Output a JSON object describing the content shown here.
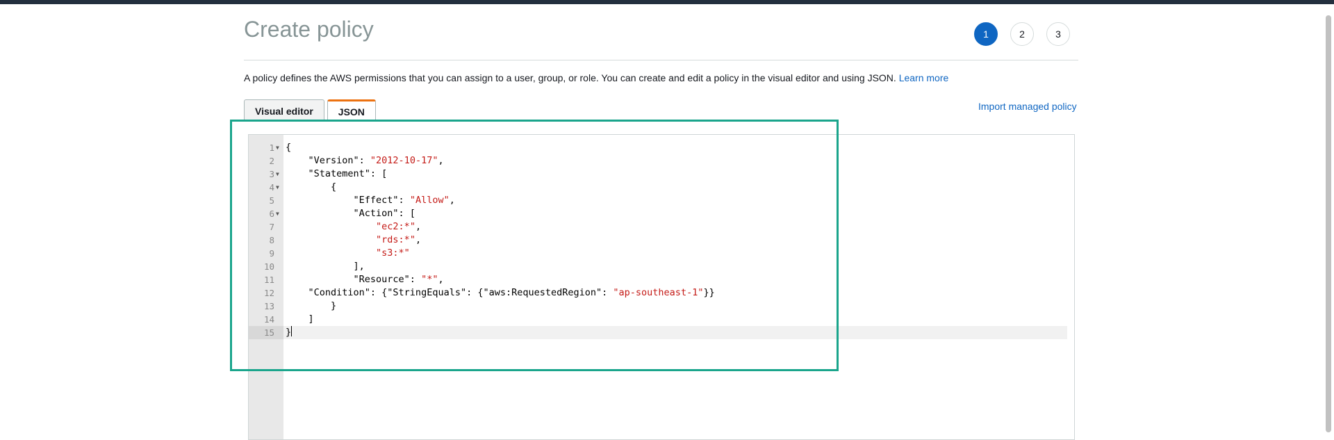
{
  "page": {
    "title": "Create policy",
    "description": "A policy defines the AWS permissions that you can assign to a user, group, or role. You can create and edit a policy in the visual editor and using JSON.",
    "learn_more": "Learn more"
  },
  "steps": [
    "1",
    "2",
    "3"
  ],
  "active_step": "1",
  "tabs": [
    {
      "label": "Visual editor",
      "active": false
    },
    {
      "label": "JSON",
      "active": true
    }
  ],
  "import_managed_policy": "Import managed policy",
  "editor": {
    "line_numbers": [
      "1",
      "2",
      "3",
      "4",
      "5",
      "6",
      "7",
      "8",
      "9",
      "10",
      "11",
      "12",
      "13",
      "14",
      "15"
    ],
    "current_line": "15"
  },
  "colors": {
    "accent": "#0f66c2",
    "active_tab": "#ec7211",
    "string": "#c41a16",
    "highlight_box": "#1aa58c"
  }
}
